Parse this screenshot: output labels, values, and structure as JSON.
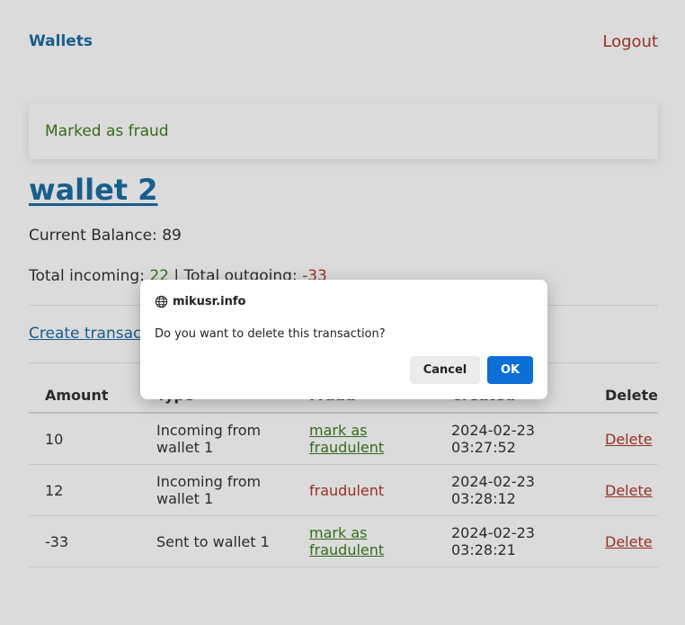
{
  "nav": {
    "brand": "Wallets",
    "logout": "Logout"
  },
  "flash": {
    "message": "Marked as fraud"
  },
  "wallet": {
    "title": "wallet 2",
    "balance_label": "Current Balance: ",
    "balance": "89",
    "incoming_label": "Total incoming: ",
    "incoming": "22",
    "separator": " | ",
    "outgoing_label": "Total outgoing: ",
    "outgoing": "-33"
  },
  "create_link": "Create transaction",
  "table": {
    "headers": [
      "Amount",
      "Type",
      "Fraud",
      "Created",
      "Delete"
    ],
    "rows": [
      {
        "amount": "10",
        "type": "Incoming from wallet 1",
        "fraud": "mark as fraudulent",
        "created": "2024-02-23 03:27:52",
        "delete": "Delete"
      },
      {
        "amount": "12",
        "type": "Incoming from wallet 1",
        "fraud": "fraudulent",
        "created": "2024-02-23 03:28:12",
        "delete": "Delete"
      },
      {
        "amount": "-33",
        "type": "Sent to wallet 1",
        "fraud": "mark as fraudulent",
        "created": "2024-02-23 03:28:21",
        "delete": "Delete"
      }
    ]
  },
  "dialog": {
    "origin": "mikusr.info",
    "origin_icon": "globe-icon",
    "message": "Do you want to delete this transaction?",
    "cancel_label": "Cancel",
    "ok_label": "OK"
  },
  "colors": {
    "link_blue": "#1c6ea4",
    "green": "#3f7d24",
    "red": "#b03a2e",
    "ok_button": "#0b6fd6"
  }
}
